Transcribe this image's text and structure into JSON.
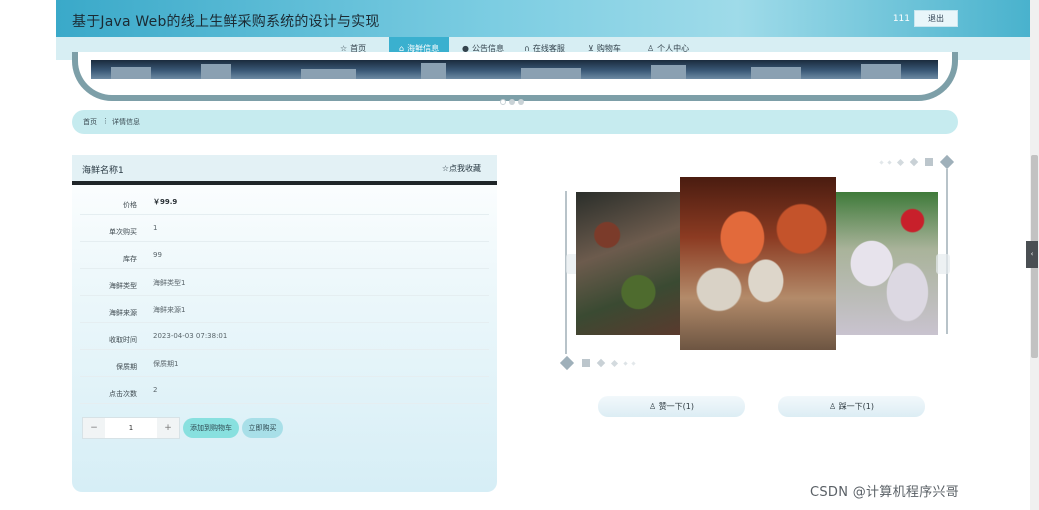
{
  "header": {
    "site_title": "基于Java Web的线上生鲜采购系统的设计与实现",
    "username": "111",
    "logout_label": "退出"
  },
  "nav": {
    "items": [
      {
        "label": "首页",
        "icon": "star-icon",
        "active": false
      },
      {
        "label": "海鲜信息",
        "icon": "home-icon",
        "active": true
      },
      {
        "label": "公告信息",
        "icon": "info-icon",
        "active": false
      },
      {
        "label": "在线客服",
        "icon": "headset-icon",
        "active": false
      },
      {
        "label": "购物车",
        "icon": "cart-icon",
        "active": false
      },
      {
        "label": "个人中心",
        "icon": "user-icon",
        "active": false
      }
    ]
  },
  "breadcrumb": {
    "home": "首页",
    "separator": "⋮",
    "current": "详情信息"
  },
  "detail": {
    "name": "海鲜名称1",
    "favorite_label": "点我收藏",
    "fields": [
      {
        "label": "价格",
        "value": "￥99.9"
      },
      {
        "label": "单次购买",
        "value": "1"
      },
      {
        "label": "库存",
        "value": "99"
      },
      {
        "label": "海鲜类型",
        "value": "海鲜类型1"
      },
      {
        "label": "海鲜来源",
        "value": "海鲜来源1"
      },
      {
        "label": "收取时间",
        "value": "2023-04-03 07:38:01"
      },
      {
        "label": "保质期",
        "value": "保质期1"
      },
      {
        "label": "点击次数",
        "value": "2"
      }
    ],
    "quantity": "1",
    "minus_label": "−",
    "plus_label": "+",
    "add_to_cart_label": "添加到购物车",
    "buy_now_label": "立即购买"
  },
  "votes": {
    "up_label": "赞一下(1)",
    "down_label": "踩一下(1)"
  },
  "banner": {
    "slide_count": 3,
    "active_slide": 1
  },
  "watermark": "CSDN @计算机程序兴哥",
  "colors": {
    "accent": "#3ab0cf",
    "nav_bg": "#d7eef3",
    "crumb_bg": "#c6ebef",
    "cart_btn": "#88e0df"
  }
}
